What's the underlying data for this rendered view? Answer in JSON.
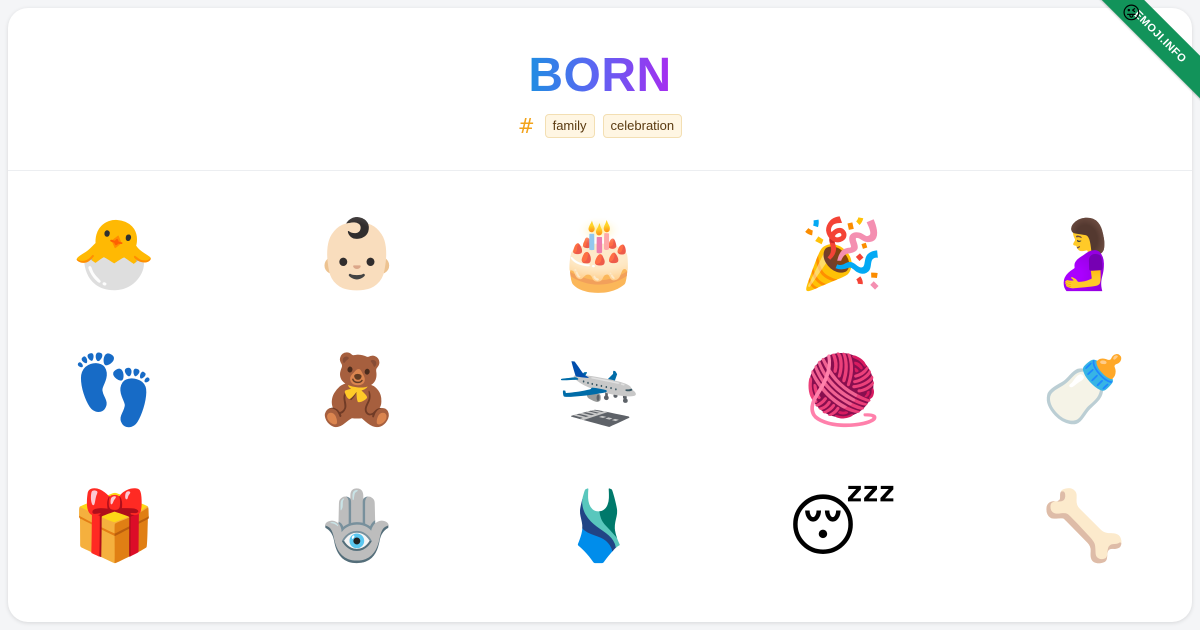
{
  "title": "BORN",
  "tags_icon": "hash-icon",
  "tags": [
    "family",
    "celebration"
  ],
  "ribbon": {
    "label": "EMOJI.INFO",
    "icon": "😜"
  },
  "emojis": [
    {
      "char": "🐣",
      "name": "hatching-chick"
    },
    {
      "char": "👶🏻",
      "name": "baby"
    },
    {
      "char": "🎂",
      "name": "birthday-cake"
    },
    {
      "char": "🎉",
      "name": "party-popper"
    },
    {
      "char": "🤰",
      "name": "pregnant-woman"
    },
    {
      "char": "👣",
      "name": "footprints"
    },
    {
      "char": "🧸",
      "name": "teddy-bear"
    },
    {
      "char": "🛬",
      "name": "airplane-arrival"
    },
    {
      "char": "🧶",
      "name": "yarn"
    },
    {
      "char": "🍼",
      "name": "baby-bottle"
    },
    {
      "char": "🎁",
      "name": "wrapped-gift"
    },
    {
      "char": "🪬",
      "name": "hamsa"
    },
    {
      "char": "🩱",
      "name": "one-piece-swimsuit"
    },
    {
      "char": "😴",
      "name": "sleeping-face"
    },
    {
      "char": "🦴",
      "name": "bone"
    }
  ]
}
